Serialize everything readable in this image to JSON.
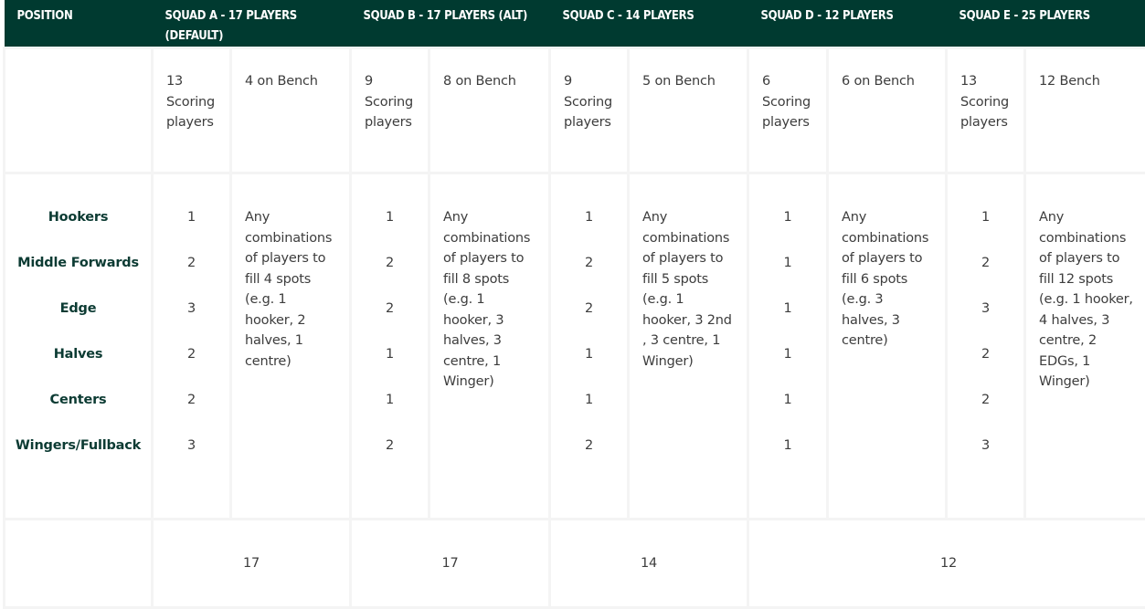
{
  "header": {
    "position_label": "POSITION",
    "squads": [
      {
        "label": "SQUAD A - 17 PLAYERS (DEFAULT)"
      },
      {
        "label": "SQUAD B - 17 PLAYERS (ALT)"
      },
      {
        "label": "SQUAD C - 14 PLAYERS"
      },
      {
        "label": "SQUAD D - 12 PLAYERS"
      },
      {
        "label": "SQUAD E - 25 PLAYERS"
      }
    ]
  },
  "summary": [
    {
      "scoring": "13 Scoring players",
      "bench": "4 on Bench"
    },
    {
      "scoring": "9 Scoring players",
      "bench": "8 on Bench"
    },
    {
      "scoring": "9 Scoring players",
      "bench": "5 on Bench"
    },
    {
      "scoring": "6 Scoring players",
      "bench": "6 on Bench"
    },
    {
      "scoring": "13 Scoring players",
      "bench": "12 Bench"
    }
  ],
  "positions": [
    "Hookers",
    "Middle Forwards",
    "Edge",
    "Halves",
    "Centers",
    "Wingers/Fullback"
  ],
  "squads": [
    {
      "counts": [
        "1",
        "2",
        "3",
        "2",
        "2",
        "3"
      ],
      "bench_note": "Any combinations of players to fill 4 spots (e.g. 1 hooker, 2 halves, 1 centre)"
    },
    {
      "counts": [
        "1",
        "2",
        "2",
        "1",
        "1",
        "2"
      ],
      "bench_note": "Any combinations of players to fill 8 spots (e.g. 1 hooker, 3 halves, 3 centre, 1 Winger)"
    },
    {
      "counts": [
        "1",
        "2",
        "2",
        "1",
        "1",
        "2"
      ],
      "bench_note": "Any combinations of players to fill 5 spots (e.g. 1 hooker, 3 2nd , 3 centre, 1 Winger)"
    },
    {
      "counts": [
        "1",
        "1",
        "1",
        "1",
        "1",
        "1"
      ],
      "bench_note": "Any combinations of players to fill 6 spots (e.g. 3 halves, 3 centre)"
    },
    {
      "counts": [
        "1",
        "2",
        "3",
        "2",
        "2",
        "3"
      ],
      "bench_note": "Any combinations of players to fill 12 spots (e.g. 1 hooker, 4 halves, 3 centre, 2 EDGs, 1 Winger)"
    }
  ],
  "totals": [
    "17",
    "17",
    "14",
    "12"
  ]
}
